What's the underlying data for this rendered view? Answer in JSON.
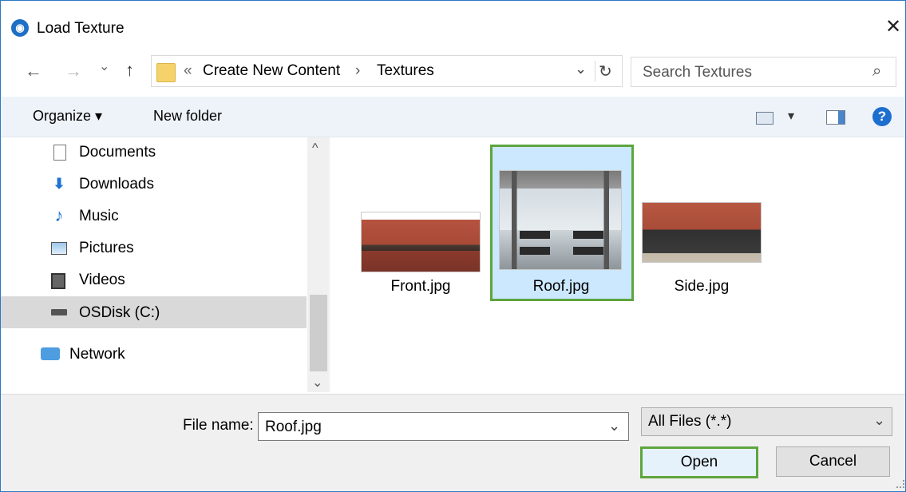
{
  "dialog": {
    "title": "Load Texture",
    "close_glyph": "✕",
    "app_icon_glyph": "◉"
  },
  "nav": {
    "back_glyph": "←",
    "forward_glyph": "→",
    "recent_glyph": "⌄",
    "up_glyph": "↑",
    "breadcrumb_prefix": "«",
    "breadcrumb": [
      "Create New Content",
      "Textures"
    ],
    "breadcrumb_sep": "›",
    "address_dropdown_glyph": "⌄",
    "refresh_glyph": "↻",
    "search_placeholder": "Search Textures",
    "search_glyph": "⌕"
  },
  "toolbar": {
    "organize_label": "Organize ▾",
    "new_folder_label": "New folder",
    "view_dropdown_glyph": "▾",
    "help_glyph": "?"
  },
  "sidebar": {
    "items": [
      {
        "label": "Documents",
        "icon": "document-icon"
      },
      {
        "label": "Downloads",
        "icon": "download-arrow-icon"
      },
      {
        "label": "Music",
        "icon": "music-note-icon"
      },
      {
        "label": "Pictures",
        "icon": "pictures-icon"
      },
      {
        "label": "Videos",
        "icon": "video-film-icon"
      },
      {
        "label": "OSDisk (C:)",
        "icon": "drive-icon",
        "selected": true
      },
      {
        "label": "Network",
        "icon": "network-icon"
      }
    ],
    "scroll_up_glyph": "^",
    "scroll_down_glyph": "⌄"
  },
  "files": [
    {
      "name": "Front.jpg",
      "selected": false
    },
    {
      "name": "Roof.jpg",
      "selected": true
    },
    {
      "name": "Side.jpg",
      "selected": false
    }
  ],
  "footer": {
    "file_name_label": "File name:",
    "file_name_value": "Roof.jpg",
    "file_name_dropdown_glyph": "⌄",
    "file_type_value": "All Files (*.*)",
    "file_type_dropdown_glyph": "⌄",
    "open_label": "Open",
    "cancel_label": "Cancel"
  },
  "colors": {
    "accent_green": "#5ea53e",
    "selection_blue": "#cce8ff",
    "help_blue": "#1d6fcf"
  }
}
